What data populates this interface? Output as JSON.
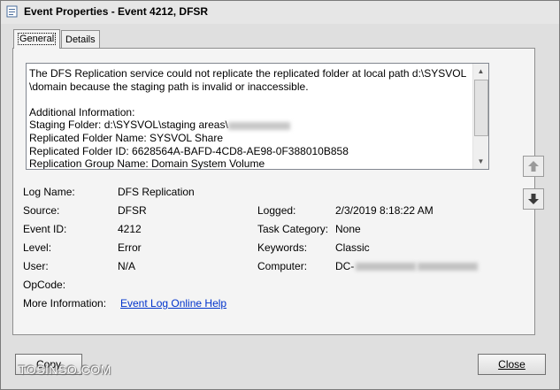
{
  "window": {
    "title": "Event Properties - Event 4212, DFSR"
  },
  "tabs": [
    {
      "label": "General"
    },
    {
      "label": "Details"
    }
  ],
  "description": {
    "line1": "The DFS Replication service could not replicate the replicated folder at local path d:\\SYSVOL",
    "line2": "\\domain because the staging path is invalid or inaccessible.",
    "line3": "",
    "line4": "Additional Information:",
    "line5": "Staging Folder: d:\\SYSVOL\\staging areas\\",
    "line6": "Replicated Folder Name: SYSVOL Share",
    "line7": "Replicated Folder ID: 6628564A-BAFD-4CD8-AE98-0F388010B858",
    "line8": "Replication Group Name: Domain System Volume"
  },
  "fields": {
    "log_name": {
      "label": "Log Name:",
      "value": "DFS Replication"
    },
    "source": {
      "label": "Source:",
      "value": "DFSR"
    },
    "logged": {
      "label": "Logged:",
      "value": "2/3/2019 8:18:22 AM"
    },
    "event_id": {
      "label": "Event ID:",
      "value": "4212"
    },
    "task_category": {
      "label": "Task Category:",
      "value": "None"
    },
    "level": {
      "label": "Level:",
      "value": "Error"
    },
    "keywords": {
      "label": "Keywords:",
      "value": "Classic"
    },
    "user": {
      "label": "User:",
      "value": "N/A"
    },
    "computer": {
      "label": "Computer:",
      "value": "DC-"
    },
    "opcode": {
      "label": "OpCode:",
      "value": ""
    },
    "more_info": {
      "label": "More Information:",
      "link": "Event Log Online Help"
    }
  },
  "buttons": {
    "copy": "Copy",
    "close": "Close"
  },
  "icons": {
    "title": "event-properties-icon",
    "up": "up-arrow-icon",
    "down": "down-arrow-icon"
  },
  "watermark": "TOSINSO.COM"
}
